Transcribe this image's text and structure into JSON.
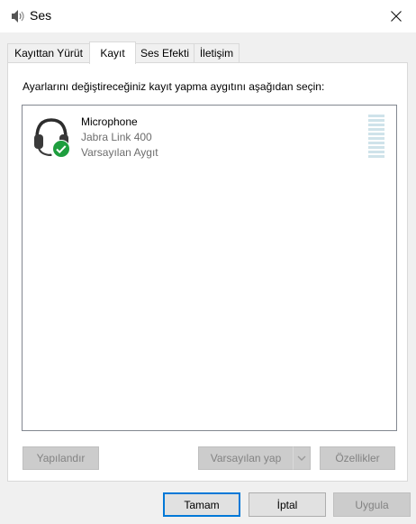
{
  "window": {
    "title": "Ses"
  },
  "tabs": [
    {
      "label": "Kayıttan Yürüt"
    },
    {
      "label": "Kayıt"
    },
    {
      "label": "Ses Efekti"
    },
    {
      "label": "İletişim"
    }
  ],
  "panel": {
    "instruction": "Ayarlarını değiştireceğiniz kayıt yapma aygıtını aşağıdan seçin:",
    "devices": [
      {
        "name": "Microphone",
        "description": "Jabra Link 400",
        "status": "Varsayılan Aygıt",
        "icon": "headset-icon",
        "badge": "default-check-icon"
      }
    ],
    "buttons": {
      "configure": "Yapılandır",
      "set_default": "Varsayılan yap",
      "properties": "Özellikler"
    }
  },
  "footer": {
    "ok": "Tamam",
    "cancel": "İptal",
    "apply": "Uygula"
  },
  "colors": {
    "accent": "#0078d7",
    "check_badge": "#1e9e3e",
    "level_meter": "#cfe3ea"
  }
}
